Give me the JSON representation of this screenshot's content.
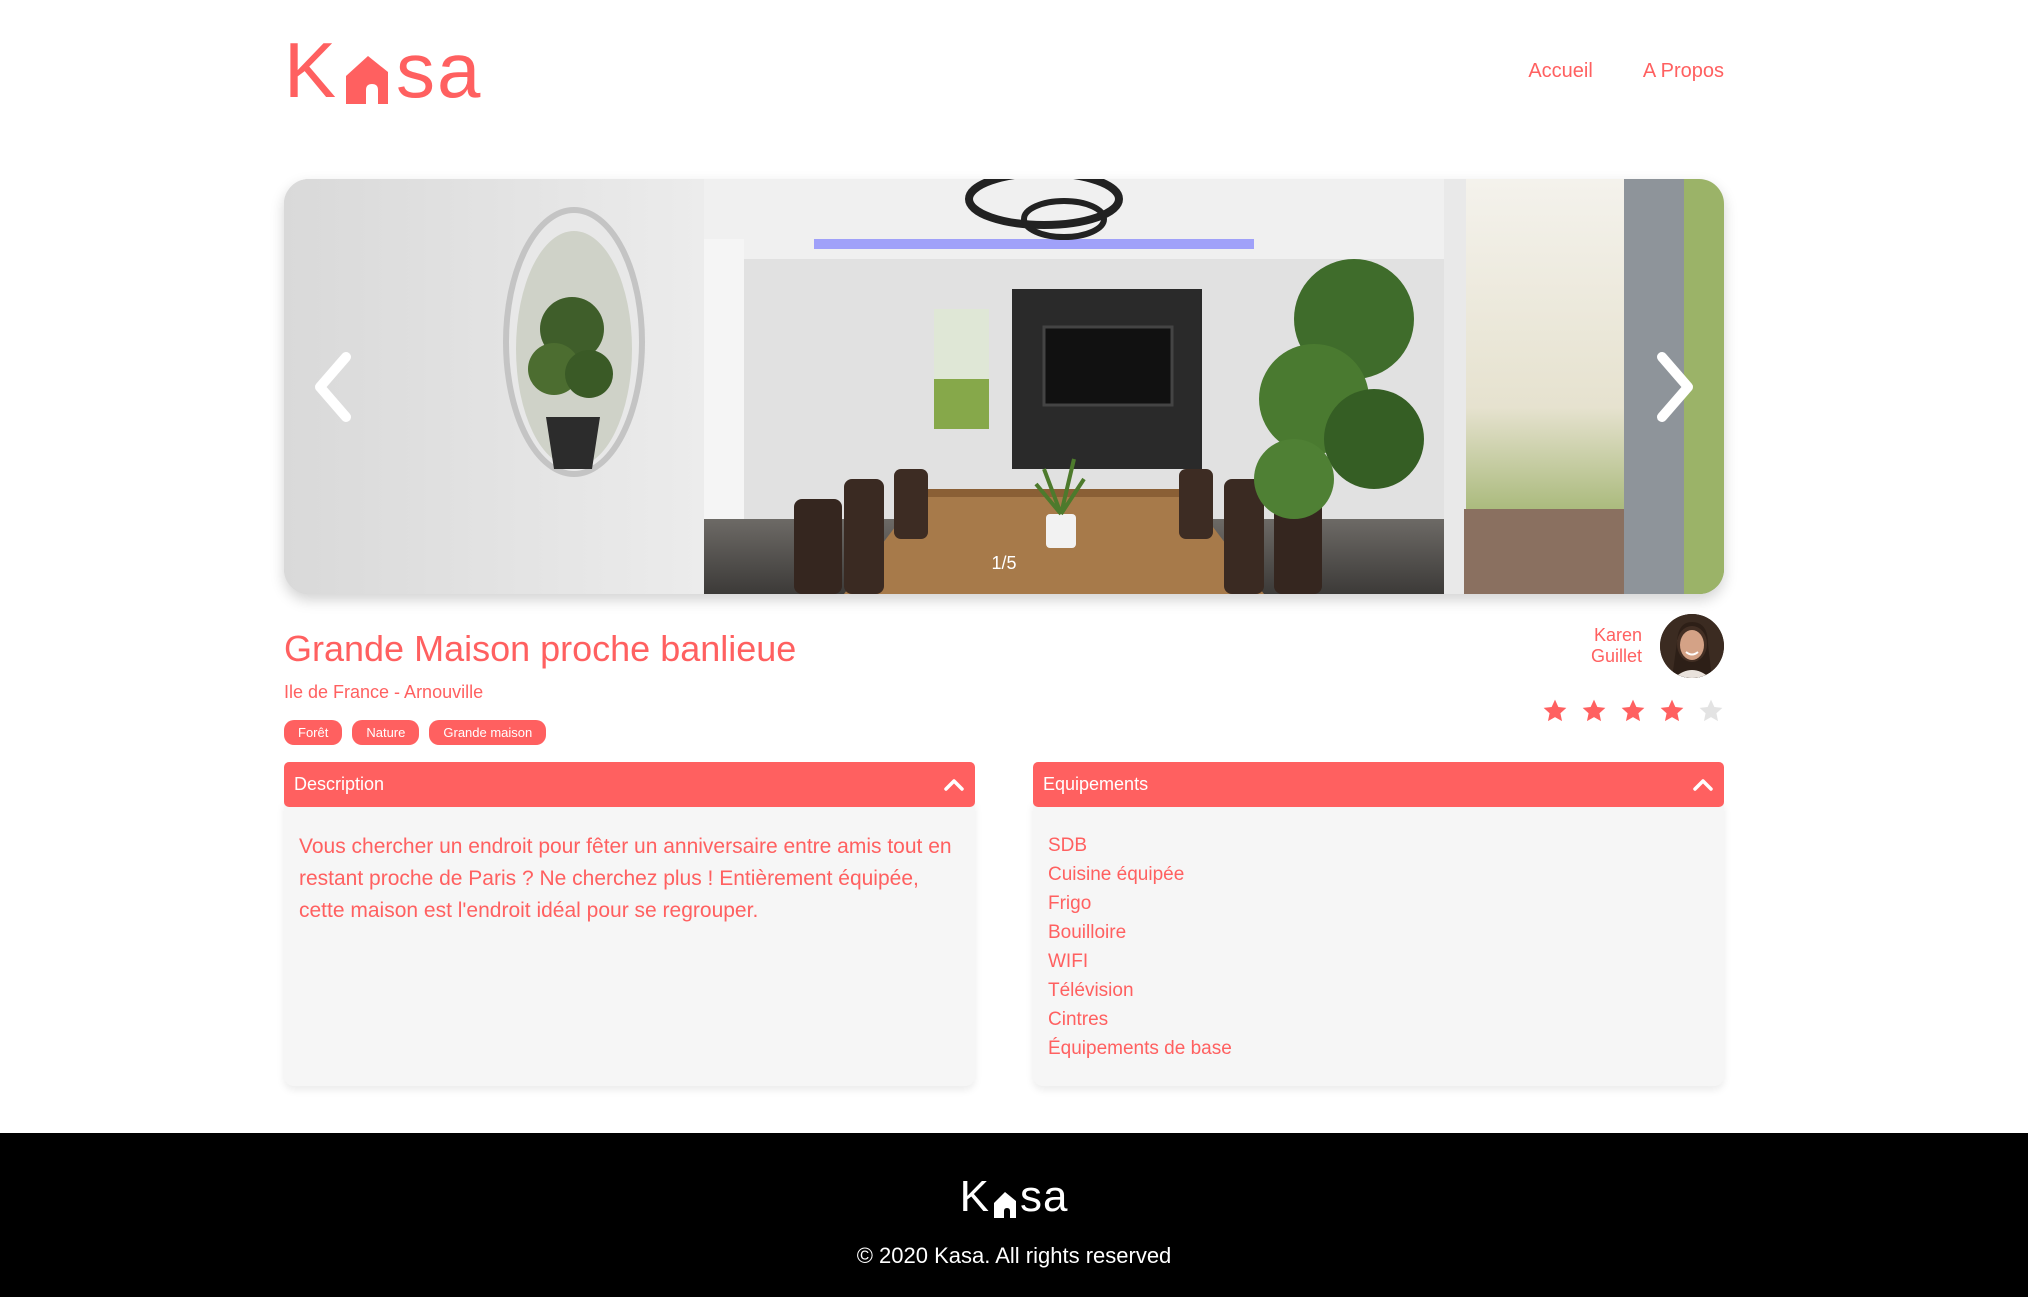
{
  "header": {
    "logo_left": "K",
    "logo_right": "sa",
    "nav": [
      "Accueil",
      "A Propos"
    ]
  },
  "carousel": {
    "counter": "1/5",
    "current": 1,
    "total": 5
  },
  "listing": {
    "title": "Grande Maison proche banlieue",
    "location": "Ile de France - Arnouville",
    "tags": [
      "Forêt",
      "Nature",
      "Grande maison"
    ],
    "host_first": "Karen",
    "host_last": "Guillet",
    "rating": 4,
    "rating_max": 5
  },
  "description": {
    "label": "Description",
    "text": "Vous chercher un endroit pour fêter un anniversaire entre amis tout en restant proche de Paris ? Ne cherchez plus ! Entièrement équipée, cette maison est l'endroit idéal pour se regrouper."
  },
  "equipments": {
    "label": "Equipements",
    "items": [
      "SDB",
      "Cuisine équipée",
      "Frigo",
      "Bouilloire",
      "WIFI",
      "Télévision",
      "Cintres",
      "Équipements de base"
    ]
  },
  "footer": {
    "logo_left": "K",
    "logo_right": "sa",
    "copyright": "© 2020 Kasa. All rights reserved"
  },
  "colors": {
    "brand": "#FF6060",
    "panel": "#F6F6F6",
    "star_off": "#E3E3E3",
    "footer_bg": "#000000"
  }
}
